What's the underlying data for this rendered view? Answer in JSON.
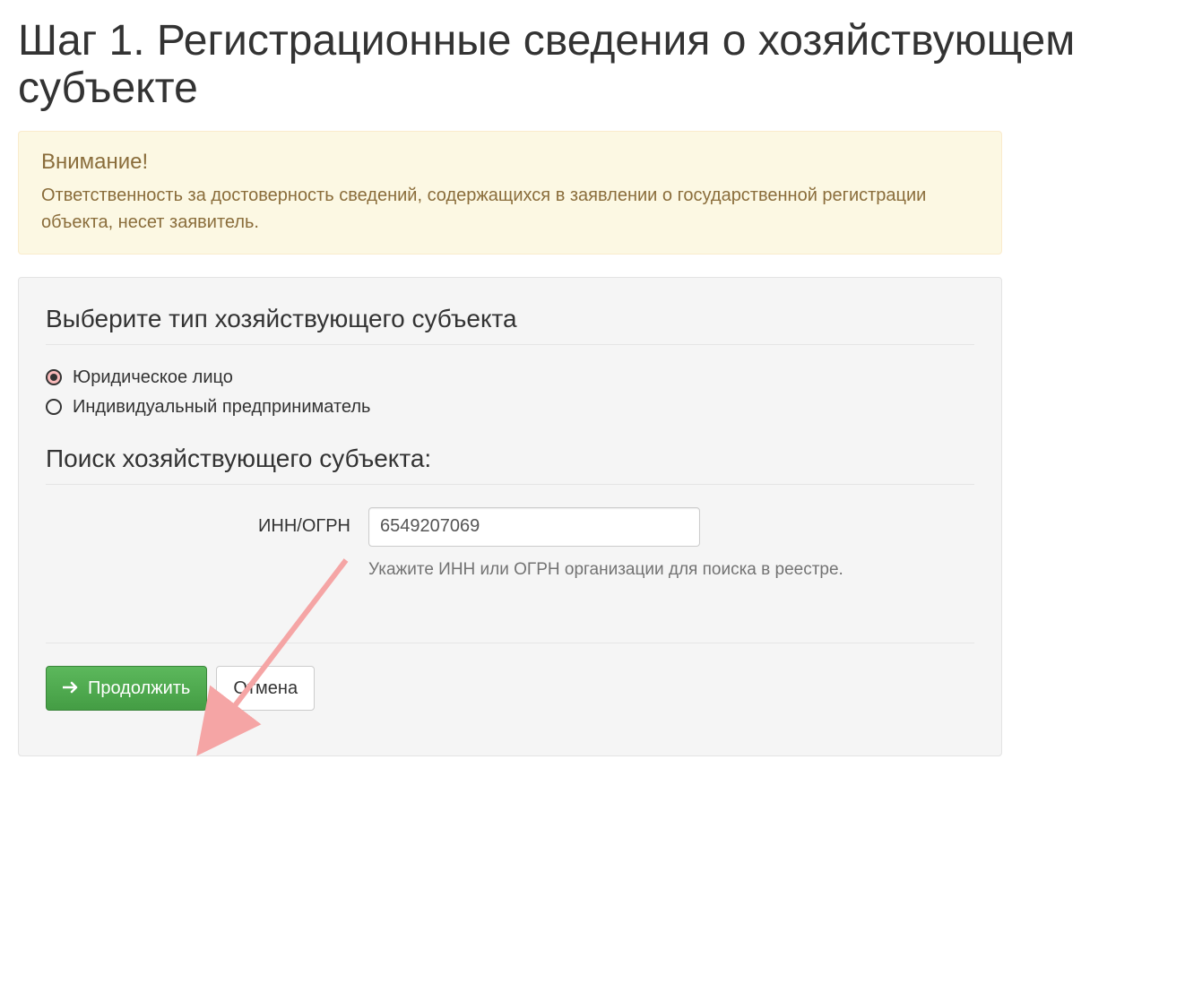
{
  "page": {
    "title": "Шаг 1. Регистрационные сведения о хозяйствующем субъекте"
  },
  "alert": {
    "heading": "Внимание!",
    "body": "Ответственность за достоверность сведений, содержащихся в заявлении о государственной регистрации объекта, несет заявитель."
  },
  "form": {
    "section1_title": "Выберите тип хозяйствующего субъекта",
    "radio_options": {
      "option1": {
        "label": "Юридическое лицо",
        "checked": true
      },
      "option2": {
        "label": "Индивидуальный предприниматель",
        "checked": false
      }
    },
    "section2_title": "Поиск хозяйствующего субъекта:",
    "inn_ogrn": {
      "label": "ИНН/ОГРН",
      "value": "6549207069",
      "help": "Укажите ИНН или ОГРН организации для поиска в реестре."
    },
    "buttons": {
      "continue": "Продолжить",
      "cancel": "Отмена"
    }
  },
  "colors": {
    "success": "#5cb85c",
    "warning_bg": "#fcf8e3",
    "warning_text": "#8a6d3b",
    "annotation_arrow": "#f5a5a5"
  }
}
